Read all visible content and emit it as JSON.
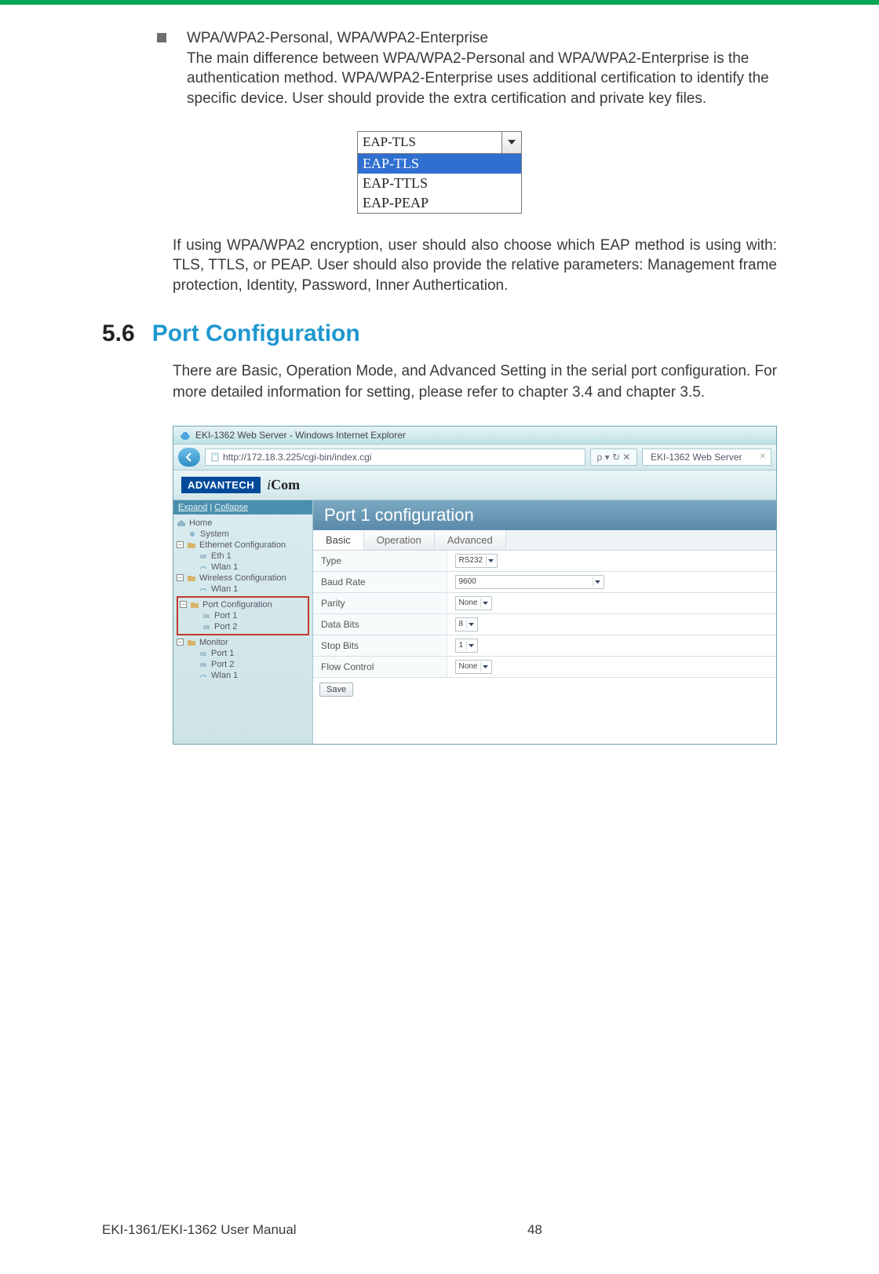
{
  "bullet": {
    "title": "WPA/WPA2-Personal, WPA/WPA2-Enterprise",
    "body": "The main difference between WPA/WPA2-Personal and WPA/WPA2-Enterprise is the authentication method. WPA/WPA2-Enterprise uses additional certification to identify the specific device. User should provide the extra certification and private key files."
  },
  "dropdown": {
    "selected": "EAP-TLS",
    "options": [
      "EAP-TLS",
      "EAP-TTLS",
      "EAP-PEAP"
    ]
  },
  "eap_paragraph": "If using WPA/WPA2 encryption, user should also choose which EAP method is using with: TLS, TTLS, or PEAP. User should also provide the relative parameters: Management frame protection, Identity, Password, Inner Authertication.",
  "section": {
    "number": "5.6",
    "title": "Port Configuration",
    "body": "There are Basic, Operation Mode, and Advanced Setting in the serial port configuration. For more detailed information for setting, please refer to chapter 3.4 and chapter 3.5."
  },
  "browser": {
    "window_title": "EKI-1362 Web Server - Windows Internet Explorer",
    "url": "http://172.18.3.225/cgi-bin/index.cgi",
    "search_hint": "ρ ▾ ↻ ✕",
    "tab_label": "EKI-1362 Web Server",
    "brand": "ADVANTECH",
    "brand_sub_i": "i",
    "brand_sub": "Com",
    "side_links": {
      "expand": "Expand",
      "sep": " | ",
      "collapse": "Collapse"
    },
    "tree": {
      "home": "Home",
      "system": "System",
      "eth_cfg": "Ethernet Configuration",
      "eth1": "Eth 1",
      "wlan1a": "Wlan 1",
      "wifi_cfg": "Wireless Configuration",
      "wlan1b": "Wlan 1",
      "port_cfg": "Port Configuration",
      "port1": "Port 1",
      "port2": "Port 2",
      "monitor": "Monitor",
      "mport1": "Port 1",
      "mport2": "Port 2",
      "mwlan1": "Wlan 1"
    },
    "main_title": "Port 1 configuration",
    "tabs": {
      "basic": "Basic",
      "operation": "Operation",
      "advanced": "Advanced"
    },
    "rows": {
      "type": {
        "label": "Type",
        "value": "RS232"
      },
      "baud": {
        "label": "Baud Rate",
        "value": "9600"
      },
      "parity": {
        "label": "Parity",
        "value": "None"
      },
      "databits": {
        "label": "Data Bits",
        "value": "8"
      },
      "stopbits": {
        "label": "Stop Bits",
        "value": "1"
      },
      "flow": {
        "label": "Flow Control",
        "value": "None"
      }
    },
    "save": "Save"
  },
  "footer": {
    "left": "EKI-1361/EKI-1362 User Manual",
    "page": "48"
  }
}
